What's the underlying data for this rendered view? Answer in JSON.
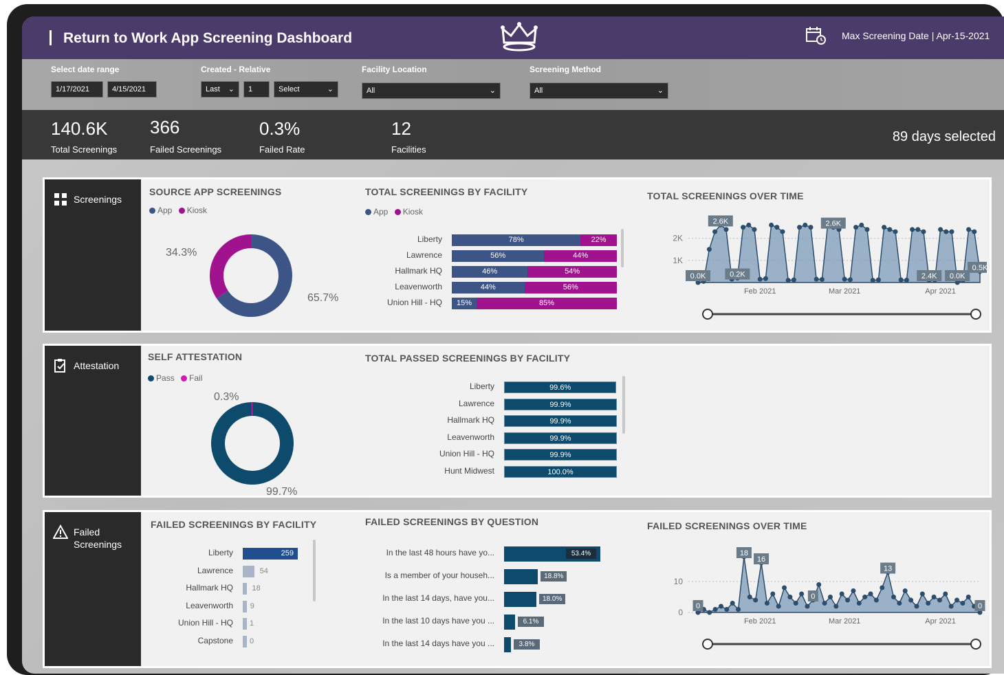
{
  "header": {
    "title": "Return to Work App Screening Dashboard",
    "max_date": "Max Screening Date | Apr-15-2021",
    "logo_icon": "crown-icon",
    "calendar_icon": "calendar-clock-icon",
    "bg_color": "#4a3b6b"
  },
  "filters": {
    "date_range_label": "Select date range",
    "date_start": "1/17/2021",
    "date_end": "4/15/2021",
    "relative_label": "Created - Relative",
    "relative_mode": "Last",
    "relative_count": "1",
    "relative_unit": "Select",
    "facility_label": "Facility Location",
    "facility_value": "All",
    "method_label": "Screening Method",
    "method_value": "All"
  },
  "kpis": {
    "total_screenings_value": "140.6K",
    "total_screenings_label": "Total Screenings",
    "failed_screenings_value": "366",
    "failed_screenings_label": "Failed Screenings",
    "failed_rate_value": "0.3%",
    "failed_rate_label": "Failed Rate",
    "facilities_value": "12",
    "facilities_label": "Facilities",
    "days_selected": "89 days selected"
  },
  "colors": {
    "app": "#3d5586",
    "kiosk": "#a1128f",
    "pass": "#0d4a6b",
    "fail": "#d11ab5",
    "area": "#7d9bb8"
  },
  "panel_screenings": {
    "tab_label": "Screenings",
    "tab_icon": "grid-icon",
    "source_title": "SOURCE APP SCREENINGS",
    "legend_app": "App",
    "legend_kiosk": "Kiosk",
    "kiosk_pct": "34.3%",
    "app_pct": "65.7%",
    "facility_title": "TOTAL SCREENINGS BY FACILITY",
    "time_title": "TOTAL SCREENINGS OVER TIME",
    "y_ticks": [
      "2K",
      "1K"
    ],
    "x_ticks": [
      "Feb 2021",
      "Mar 2021",
      "Apr 2021"
    ],
    "point_labels": [
      "0.0K",
      "2.6K",
      "0.2K",
      "2.6K",
      "2.4K",
      "0.0K",
      "0.5K"
    ]
  },
  "panel_attestation": {
    "tab_label": "Attestation",
    "tab_icon": "clipboard-icon",
    "self_title": "SELF ATTESTATION",
    "legend_pass": "Pass",
    "legend_fail": "Fail",
    "fail_pct": "0.3%",
    "pass_pct": "99.7%",
    "passed_title": "TOTAL PASSED SCREENINGS BY FACILITY"
  },
  "panel_failed": {
    "tab_label": "Failed Screenings",
    "tab_label_line1": "Failed",
    "tab_label_line2": "Screenings",
    "tab_icon": "warning-icon",
    "facility_title": "FAILED SCREENINGS BY FACILITY",
    "question_title": "FAILED SCREENINGS BY QUESTION",
    "time_title": "FAILED SCREENINGS OVER TIME",
    "y_ticks": [
      "10",
      "0"
    ],
    "x_ticks": [
      "Feb 2021",
      "Mar 2021",
      "Apr 2021"
    ],
    "point_labels": [
      "0",
      "18",
      "16",
      "13",
      "0",
      "0"
    ]
  },
  "chart_data": [
    {
      "type": "pie",
      "title": "SOURCE APP SCREENINGS",
      "categories": [
        "App",
        "Kiosk"
      ],
      "values": [
        65.7,
        34.3
      ]
    },
    {
      "type": "bar",
      "title": "TOTAL SCREENINGS BY FACILITY",
      "categories": [
        "Liberty",
        "Lawrence",
        "Hallmark HQ",
        "Leavenworth",
        "Union Hill - HQ"
      ],
      "series": [
        {
          "name": "App",
          "values": [
            78,
            56,
            46,
            44,
            15
          ]
        },
        {
          "name": "Kiosk",
          "values": [
            22,
            44,
            54,
            56,
            85
          ]
        }
      ],
      "stacked_percent": true
    },
    {
      "type": "area",
      "title": "TOTAL SCREENINGS OVER TIME",
      "x": [
        "Feb 2021",
        "Mar 2021",
        "Apr 2021"
      ],
      "ylim": [
        0,
        2800
      ],
      "values": [
        0,
        50,
        1500,
        2300,
        2600,
        2400,
        150,
        200,
        2500,
        2600,
        2400,
        150,
        180,
        2600,
        2500,
        2300,
        100,
        120,
        2500,
        2600,
        2500,
        150,
        140,
        2600,
        2500,
        2400,
        150,
        130,
        2500,
        2600,
        2400,
        100,
        120,
        2500,
        2400,
        2300,
        120,
        110,
        2400,
        2400,
        2300,
        100,
        100,
        2400,
        2300,
        2300,
        0,
        100,
        2400,
        2300,
        500
      ]
    },
    {
      "type": "pie",
      "title": "SELF ATTESTATION",
      "categories": [
        "Pass",
        "Fail"
      ],
      "values": [
        99.7,
        0.3
      ]
    },
    {
      "type": "bar",
      "title": "TOTAL PASSED SCREENINGS BY FACILITY",
      "categories": [
        "Liberty",
        "Lawrence",
        "Hallmark HQ",
        "Leavenworth",
        "Union Hill - HQ",
        "Hunt Midwest"
      ],
      "values": [
        99.6,
        99.9,
        99.9,
        99.9,
        99.9,
        100.0
      ],
      "labels": [
        "99.6%",
        "99.9%",
        "99.9%",
        "99.9%",
        "99.9%",
        "100.0%"
      ]
    },
    {
      "type": "bar",
      "title": "FAILED SCREENINGS BY FACILITY",
      "categories": [
        "Liberty",
        "Lawrence",
        "Hallmark HQ",
        "Leavenworth",
        "Union Hill - HQ",
        "Capstone"
      ],
      "values": [
        259,
        54,
        18,
        9,
        1,
        0
      ]
    },
    {
      "type": "bar",
      "title": "FAILED SCREENINGS BY QUESTION",
      "categories": [
        "In the last 48 hours have yo...",
        "Is a member of your househ...",
        "In the last 14 days, have you...",
        "In the last 10 days have you ...",
        "In the last 14 days have you ..."
      ],
      "values": [
        53.4,
        18.8,
        18.0,
        6.1,
        3.8
      ],
      "labels": [
        "53.4%",
        "18.8%",
        "18.0%",
        "6.1%",
        "3.8%"
      ]
    },
    {
      "type": "area",
      "title": "FAILED SCREENINGS OVER TIME",
      "x": [
        "Feb 2021",
        "Mar 2021",
        "Apr 2021"
      ],
      "ylim": [
        0,
        20
      ],
      "values": [
        0,
        1,
        0,
        1,
        2,
        1,
        3,
        1,
        18,
        5,
        4,
        16,
        3,
        6,
        2,
        8,
        5,
        3,
        6,
        2,
        4,
        9,
        3,
        5,
        2,
        6,
        4,
        7,
        3,
        5,
        6,
        4,
        8,
        13,
        5,
        3,
        7,
        4,
        2,
        6,
        3,
        5,
        4,
        6,
        2,
        4,
        3,
        5,
        2,
        0
      ]
    }
  ]
}
